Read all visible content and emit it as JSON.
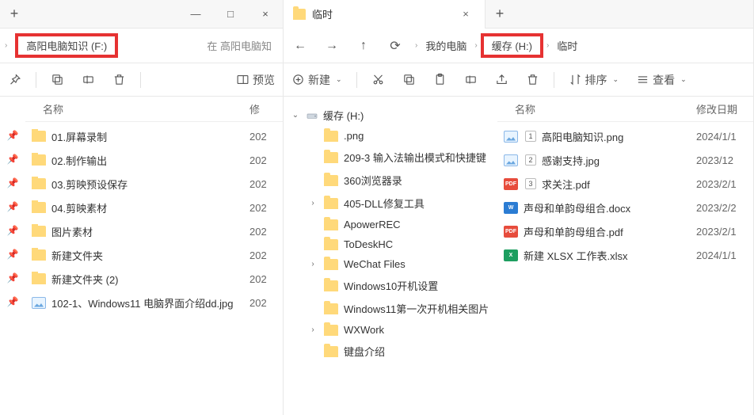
{
  "left": {
    "tab_add": "+",
    "tab_close": "×",
    "win_min": "—",
    "win_max": "□",
    "win_close": "×",
    "nav_back": "←",
    "crumb_sep": "›",
    "crumb1": "高阳电脑知识 (F:)",
    "search_hint": "在 高阳电脑知",
    "toolbar": {
      "delete": "",
      "preview": "预览"
    },
    "col_name": "名称",
    "col_mod": "修",
    "items": [
      {
        "type": "folder",
        "name": "01.屏幕录制",
        "mod": "202"
      },
      {
        "type": "folder",
        "name": "02.制作输出",
        "mod": "202"
      },
      {
        "type": "folder",
        "name": "03.剪映预设保存",
        "mod": "202"
      },
      {
        "type": "folder",
        "name": "04.剪映素材",
        "mod": "202"
      },
      {
        "type": "folder",
        "name": "图片素材",
        "mod": "202"
      },
      {
        "type": "folder",
        "name": "新建文件夹",
        "mod": "202"
      },
      {
        "type": "folder",
        "name": "新建文件夹 (2)",
        "mod": "202"
      },
      {
        "type": "image",
        "name": "102-1、Windows11 电脑界面介绍dd.jpg",
        "mod": "202"
      }
    ]
  },
  "right": {
    "tab_title": "临时",
    "tab_close": "×",
    "tab_add": "+",
    "nav_back": "←",
    "nav_fwd": "→",
    "nav_up": "↑",
    "nav_refresh": "⟳",
    "crumb_sep": "›",
    "crumb1": "我的电脑",
    "crumb2": "缓存 (H:)",
    "crumb3": "临时",
    "toolbar": {
      "new": "新建",
      "sort": "排序",
      "view": "查看"
    },
    "tree_root_exp": "⌄",
    "tree_root": "缓存 (H:)",
    "tree": [
      {
        "exp": "",
        "name": ".png"
      },
      {
        "exp": "",
        "name": "209-3 输入法输出模式和快捷键"
      },
      {
        "exp": "",
        "name": "360浏览器录"
      },
      {
        "exp": "›",
        "name": "405-DLL修复工具"
      },
      {
        "exp": "",
        "name": "ApowerREC"
      },
      {
        "exp": "",
        "name": "ToDeskHC"
      },
      {
        "exp": "›",
        "name": "WeChat Files"
      },
      {
        "exp": "",
        "name": "Windows10开机设置"
      },
      {
        "exp": "",
        "name": "Windows11第一次开机相关图片"
      },
      {
        "exp": "›",
        "name": "WXWork"
      },
      {
        "exp": "",
        "name": "键盘介绍"
      }
    ],
    "col_name": "名称",
    "col_mod": "修改日期",
    "items": [
      {
        "type": "image",
        "badge": "1",
        "name": "高阳电脑知识.png",
        "mod": "2024/1/1"
      },
      {
        "type": "image",
        "badge": "2",
        "name": "感谢支持.jpg",
        "mod": "2023/12"
      },
      {
        "type": "pdf",
        "badge": "3",
        "name": "求关注.pdf",
        "mod": "2023/2/1"
      },
      {
        "type": "doc",
        "name": "声母和单韵母组合.docx",
        "mod": "2023/2/2"
      },
      {
        "type": "pdf",
        "name": "声母和单韵母组合.pdf",
        "mod": "2023/2/1"
      },
      {
        "type": "xls",
        "name": "新建 XLSX 工作表.xlsx",
        "mod": "2024/1/1"
      }
    ]
  }
}
